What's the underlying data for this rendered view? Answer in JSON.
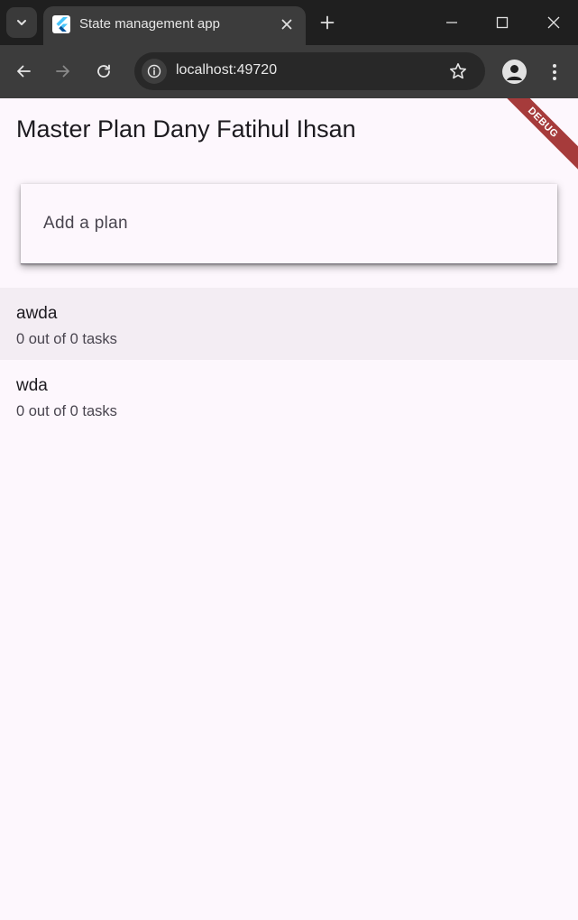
{
  "browser": {
    "tab_title": "State management app",
    "url": "localhost:49720"
  },
  "app": {
    "title": "Master Plan Dany Fatihul Ihsan",
    "debug_banner": "DEBUG",
    "plan_input_placeholder": "Add a plan",
    "plans": [
      {
        "name": "awda",
        "progress": "0 out of 0 tasks"
      },
      {
        "name": "wda",
        "progress": "0 out of 0 tasks"
      }
    ]
  },
  "colors": {
    "background": "#fdf7fd",
    "selected_row": "#f3edf3",
    "debug_ribbon": "#a63b3b",
    "chrome_dark": "#1f1f1f",
    "chrome_toolbar": "#3c3c3c"
  }
}
